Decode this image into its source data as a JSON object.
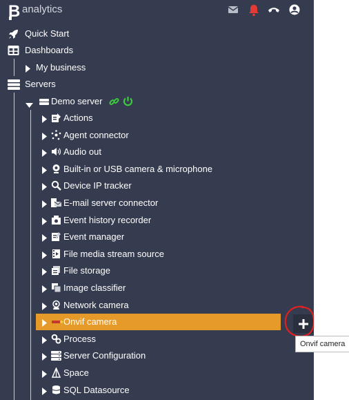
{
  "header": {
    "logo_letter": "B",
    "logo_word": "analytics",
    "icons": [
      "mail-icon",
      "bell-icon",
      "phone-hangup-icon",
      "user-account-icon"
    ],
    "colors": {
      "bell": "#e53935",
      "sidebar_bg": "#363c4f",
      "accent": "#e69a2a"
    }
  },
  "nav": {
    "quick_start": "Quick Start",
    "dashboards": "Dashboards",
    "my_business": "My business",
    "servers": "Servers",
    "demo_server": "Demo server"
  },
  "server_items": [
    "Actions",
    "Agent connector",
    "Audio out",
    "Built-in or USB camera & microphone",
    "Device IP tracker",
    "E-mail server connector",
    "Event history recorder",
    "Event manager",
    "File media stream source",
    "File storage",
    "Image classifier",
    "Network camera",
    "Onvif camera",
    "Process",
    "Server Configuration",
    "Space",
    "SQL Datasource"
  ],
  "selected_item": "Onvif camera",
  "tooltip": "Onvif camera"
}
